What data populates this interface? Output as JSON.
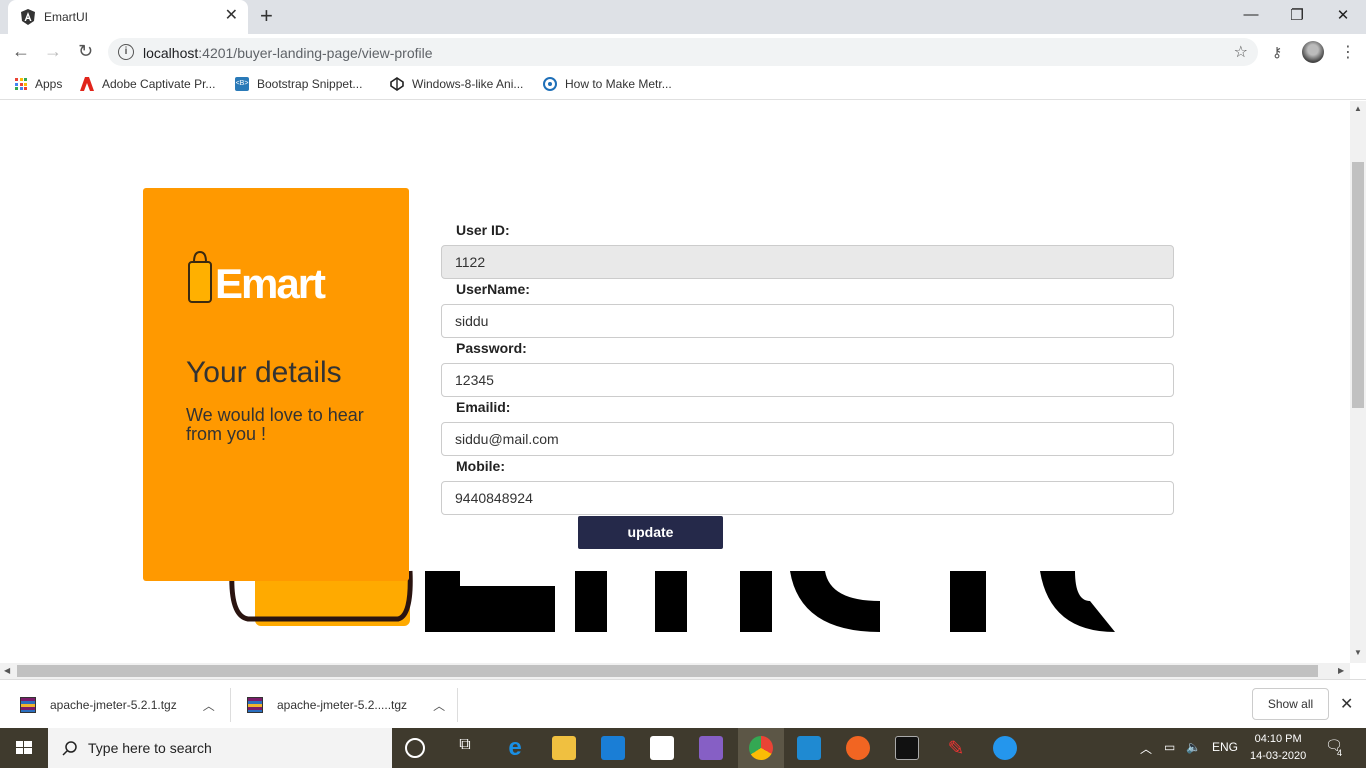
{
  "browser": {
    "tab_title": "EmartUI",
    "url_host": "localhost",
    "url_rest": ":4201/buyer-landing-page/view-profile",
    "bookmarks": [
      {
        "label": "Apps"
      },
      {
        "label": "Adobe Captivate Pr..."
      },
      {
        "label": "Bootstrap Snippet..."
      },
      {
        "label": "Windows-8-like Ani..."
      },
      {
        "label": "How to Make Metr..."
      }
    ]
  },
  "panel": {
    "brand": "Emart",
    "title": "Your details",
    "subtitle": "We would love to hear from you !"
  },
  "form": {
    "fields": [
      {
        "label": "User ID:",
        "value": "1122"
      },
      {
        "label": "UserName:",
        "value": "siddu"
      },
      {
        "label": "Password:",
        "value": "12345"
      },
      {
        "label": "Emailid:",
        "value": "siddu@mail.com"
      },
      {
        "label": "Mobile:",
        "value": "9440848924"
      }
    ],
    "submit_label": "update"
  },
  "downloads": {
    "items": [
      {
        "name": "apache-jmeter-5.2.1.tgz"
      },
      {
        "name": "apache-jmeter-5.2.....tgz"
      }
    ],
    "show_all": "Show all"
  },
  "taskbar": {
    "search_placeholder": "Type here to search",
    "language": "ENG",
    "time": "04:10 PM",
    "date": "14-03-2020",
    "notifications": "4"
  },
  "colors": {
    "panel": "#ff9900",
    "button": "#25294a"
  }
}
